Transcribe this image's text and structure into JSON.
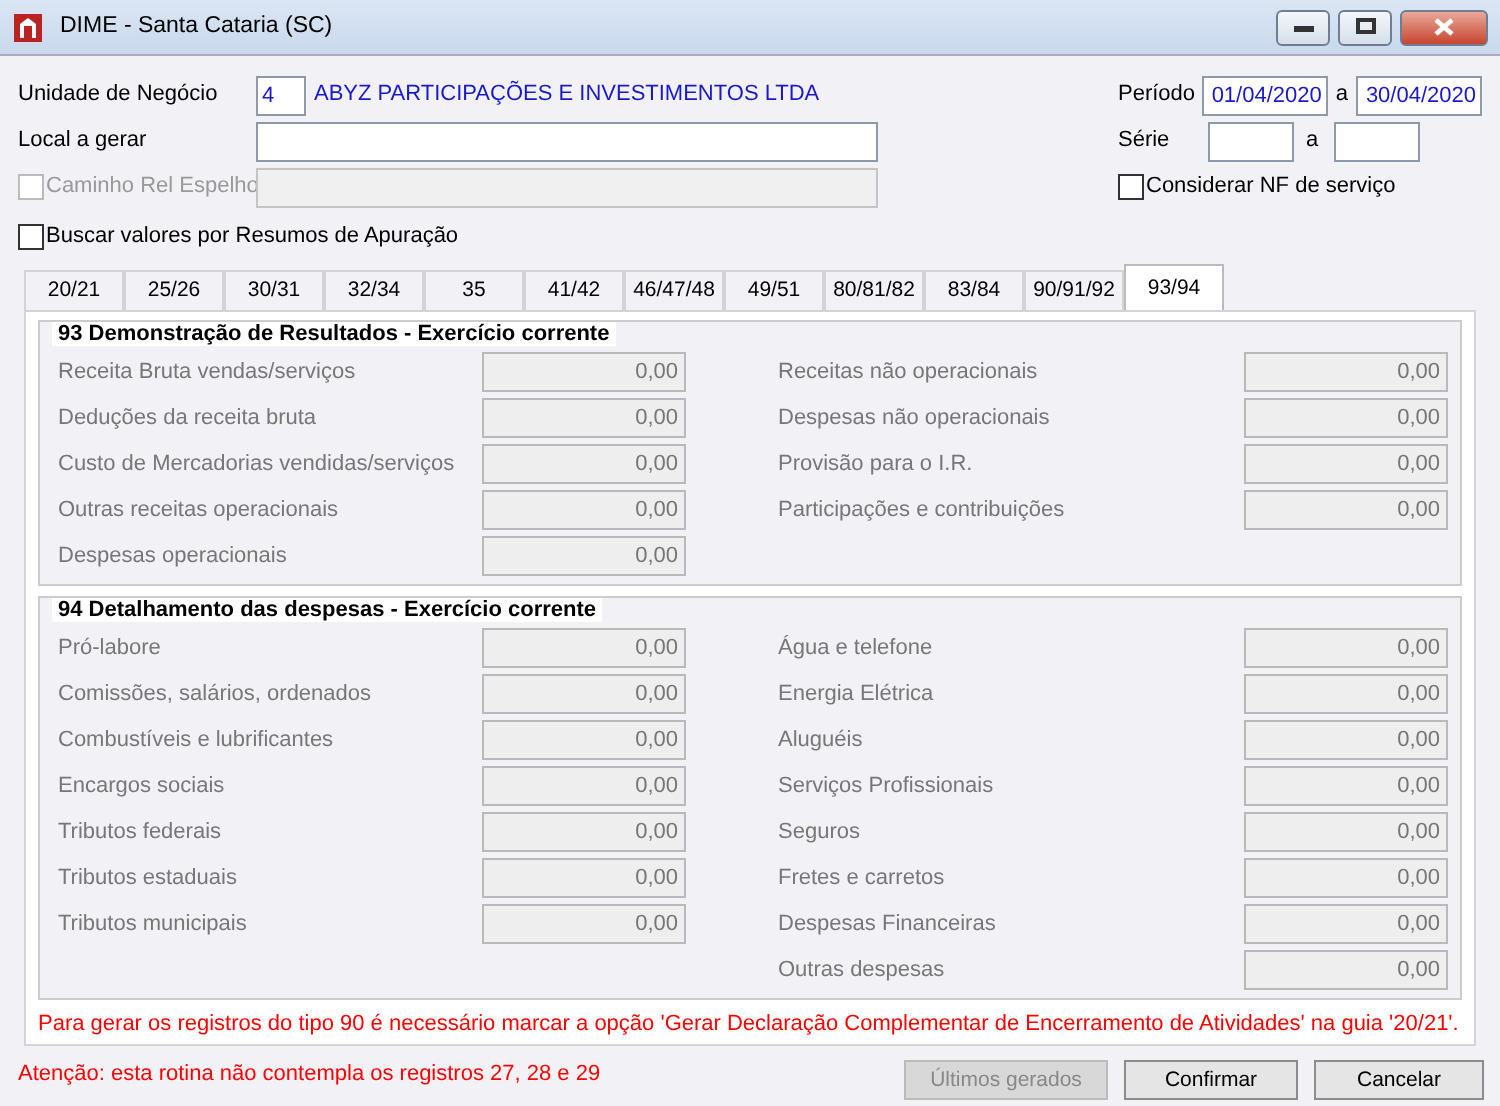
{
  "window": {
    "title": "DIME - Santa Cataria (SC)"
  },
  "header": {
    "unit": {
      "label": "Unidade de Negócio",
      "code": "4",
      "name": "ABYZ PARTICIPAÇÕES E INVESTIMENTOS LTDA"
    },
    "period": {
      "label": "Período",
      "from": "01/04/2020",
      "sep": "a",
      "to": "30/04/2020"
    },
    "local": {
      "label": "Local a gerar"
    },
    "series": {
      "label": "Série",
      "sep": "a"
    },
    "mirror_path": {
      "label": "Caminho Rel Espelho",
      "checked": false,
      "disabled": true
    },
    "service_nf": {
      "label": "Considerar NF de serviço",
      "checked": false
    },
    "summaries": {
      "label": "Buscar valores por Resumos de Apuração",
      "checked": false
    }
  },
  "tabs": [
    {
      "label": "20/21",
      "selected": false
    },
    {
      "label": "25/26",
      "selected": false
    },
    {
      "label": "30/31",
      "selected": false
    },
    {
      "label": "32/34",
      "selected": false
    },
    {
      "label": "35",
      "selected": false
    },
    {
      "label": "41/42",
      "selected": false
    },
    {
      "label": "46/47/48",
      "selected": false
    },
    {
      "label": "49/51",
      "selected": false
    },
    {
      "label": "80/81/82",
      "selected": false
    },
    {
      "label": "83/84",
      "selected": false
    },
    {
      "label": "90/91/92",
      "selected": false
    },
    {
      "label": "93/94",
      "selected": true
    }
  ],
  "groups": [
    {
      "title": "93 Demonstração de Resultados - Exercício corrente",
      "left": [
        {
          "label": "Receita Bruta vendas/serviços",
          "value": "0,00"
        },
        {
          "label": "Deduções da receita bruta",
          "value": "0,00"
        },
        {
          "label": "Custo de Mercadorias vendidas/serviços",
          "value": "0,00"
        },
        {
          "label": "Outras receitas operacionais",
          "value": "0,00"
        },
        {
          "label": "Despesas operacionais",
          "value": "0,00"
        }
      ],
      "right": [
        {
          "label": "Receitas não operacionais",
          "value": "0,00"
        },
        {
          "label": "Despesas não operacionais",
          "value": "0,00"
        },
        {
          "label": "Provisão para o I.R.",
          "value": "0,00"
        },
        {
          "label": "Participações e contribuições",
          "value": "0,00"
        }
      ]
    },
    {
      "title": "94 Detalhamento das despesas - Exercício corrente",
      "left": [
        {
          "label": "Pró-labore",
          "value": "0,00"
        },
        {
          "label": "Comissões, salários, ordenados",
          "value": "0,00"
        },
        {
          "label": "Combustíveis e lubrificantes",
          "value": "0,00"
        },
        {
          "label": "Encargos sociais",
          "value": "0,00"
        },
        {
          "label": "Tributos federais",
          "value": "0,00"
        },
        {
          "label": "Tributos estaduais",
          "value": "0,00"
        },
        {
          "label": "Tributos municipais",
          "value": "0,00"
        }
      ],
      "right": [
        {
          "label": "Água e telefone",
          "value": "0,00"
        },
        {
          "label": "Energia Elétrica",
          "value": "0,00"
        },
        {
          "label": "Aluguéis",
          "value": "0,00"
        },
        {
          "label": "Serviços Profissionais",
          "value": "0,00"
        },
        {
          "label": "Seguros",
          "value": "0,00"
        },
        {
          "label": "Fretes e carretos",
          "value": "0,00"
        },
        {
          "label": "Despesas Financeiras",
          "value": "0,00"
        },
        {
          "label": "Outras despesas",
          "value": "0,00"
        }
      ]
    }
  ],
  "notice": "Para gerar os registros do tipo 90 é necessário marcar a opção 'Gerar Declaração Complementar de Encerramento de Atividades' na guia '20/21'.",
  "warning": "Atenção: esta rotina não contempla os registros 27, 28 e 29",
  "buttons": [
    {
      "label": "Últimos gerados",
      "disabled": true
    },
    {
      "label": "Confirmar",
      "disabled": false
    },
    {
      "label": "Cancelar",
      "disabled": false
    }
  ]
}
